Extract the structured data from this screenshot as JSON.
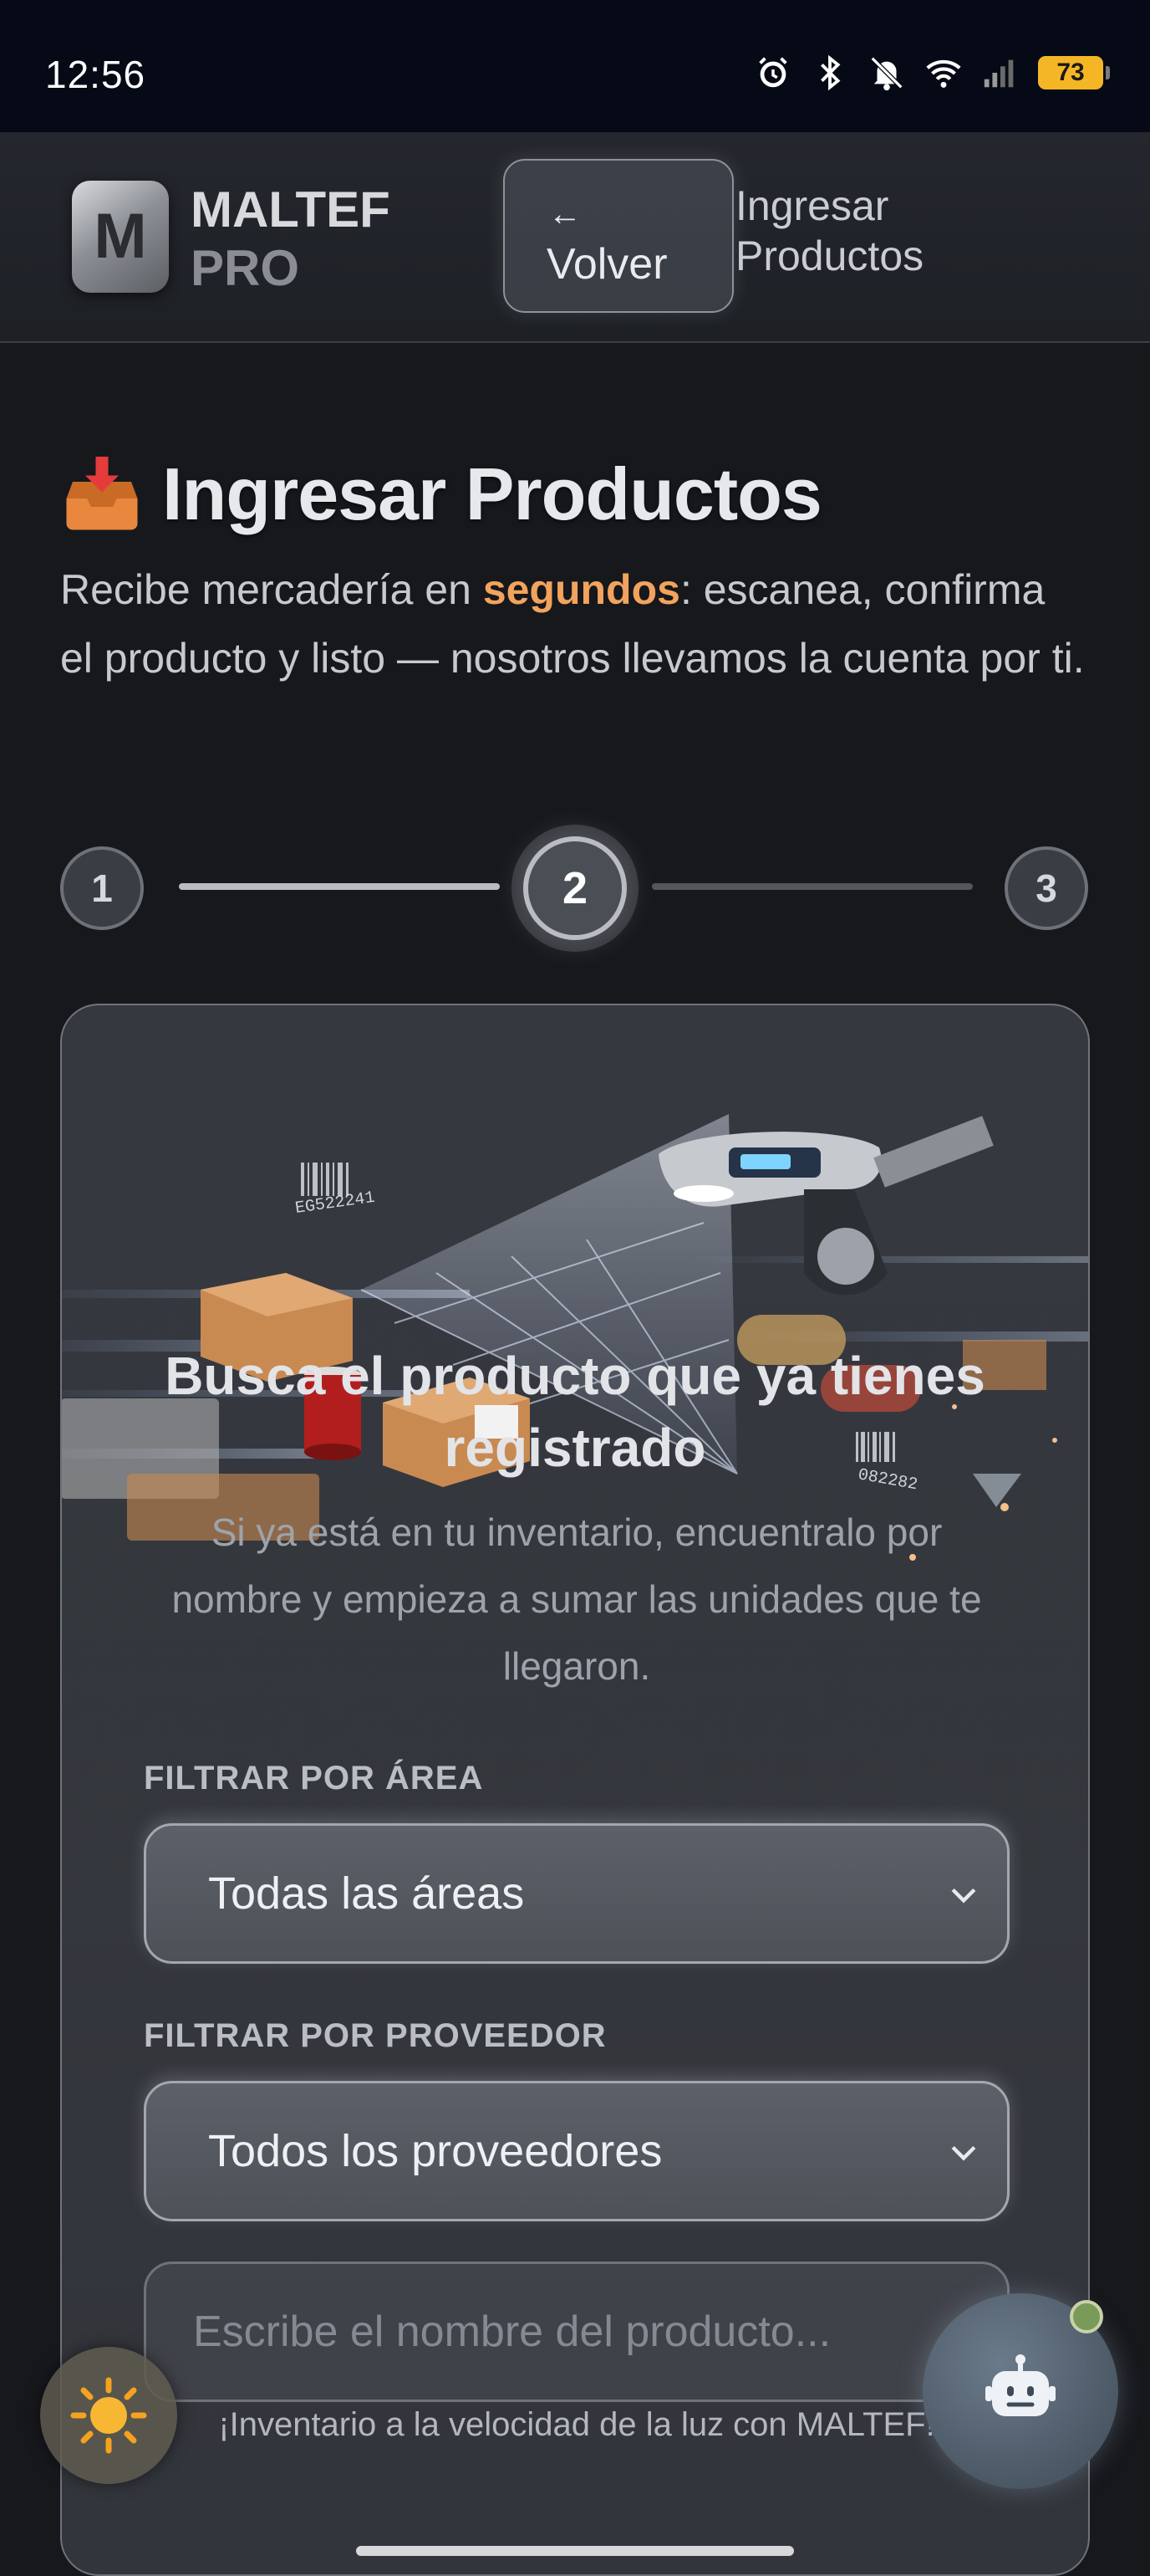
{
  "status_bar": {
    "time": "12:56",
    "battery": "73",
    "icons": [
      "alarm-icon",
      "bluetooth-icon",
      "bell-off-icon",
      "wifi-icon",
      "signal-icon",
      "battery-icon"
    ]
  },
  "header": {
    "logo_letter": "M",
    "brand_line1": "MALTEF",
    "brand_line2": "PRO",
    "back_arrow": "←",
    "back_label": "Volver",
    "title": "Ingresar Productos"
  },
  "page": {
    "title": "Ingresar Productos",
    "description_before": "Recibe mercadería en ",
    "description_highlight": "segundos",
    "description_after": ": escanea, confirma el producto y listo — nosotros llevamos la cuenta por ti.",
    "highlight_color": "#f2a35d"
  },
  "stepper": {
    "steps": [
      "1",
      "2",
      "3"
    ],
    "current": 2
  },
  "card": {
    "illustration_codes": [
      "EG522241",
      "082282"
    ],
    "title": "Busca el producto que ya tienes registrado",
    "subtitle": "Si ya está en tu inventario, encuentralo por nombre y empieza a sumar las unidades que te llegaron.",
    "area_label": "FILTRAR POR ÁREA",
    "area_value": "Todas las áreas",
    "supplier_label": "FILTRAR POR PROVEEDOR",
    "supplier_value": "Todos los proveedores",
    "search_placeholder": "Escribe el nombre del producto..."
  },
  "footer": {
    "tagline": "¡Inventario a la velocidad de la luz con MALTEF!"
  },
  "floating": {
    "theme_icon": "sun-icon",
    "assistant_icon": "robot-icon"
  }
}
